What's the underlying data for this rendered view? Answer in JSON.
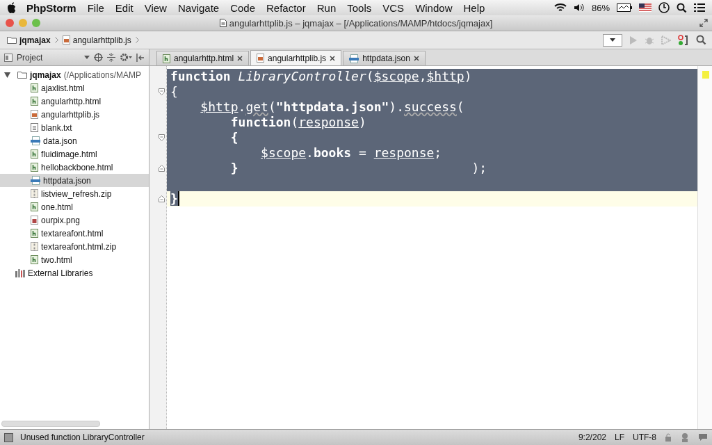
{
  "menubar": {
    "app": "PhpStorm",
    "items": [
      "File",
      "Edit",
      "View",
      "Navigate",
      "Code",
      "Refactor",
      "Run",
      "Tools",
      "VCS",
      "Window",
      "Help"
    ],
    "battery": "86%"
  },
  "window": {
    "title": "angularhttplib.js – jqmajax – [/Applications/MAMP/htdocs/jqmajax]"
  },
  "breadcrumbs": [
    {
      "label": "jqmajax",
      "kind": "folder"
    },
    {
      "label": "angularhttplib.js",
      "kind": "js"
    }
  ],
  "project_panel": {
    "title": "Project"
  },
  "tabs": [
    {
      "label": "angularhttp.html",
      "kind": "html",
      "selected": false
    },
    {
      "label": "angularhttplib.js",
      "kind": "js",
      "selected": true
    },
    {
      "label": "httpdata.json",
      "kind": "json",
      "selected": false
    }
  ],
  "tree": {
    "label": "jqmajax",
    "path": "(/Applications/MAMP",
    "expanded": true,
    "children": [
      {
        "label": "ajaxlist.html",
        "kind": "html",
        "selected": false
      },
      {
        "label": "angularhttp.html",
        "kind": "html",
        "selected": false
      },
      {
        "label": "angularhttplib.js",
        "kind": "js",
        "selected": false
      },
      {
        "label": "blank.txt",
        "kind": "text",
        "selected": false
      },
      {
        "label": "data.json",
        "kind": "json",
        "selected": false
      },
      {
        "label": "fluidimage.html",
        "kind": "html",
        "selected": false
      },
      {
        "label": "hellobackbone.html",
        "kind": "html",
        "selected": false
      },
      {
        "label": "httpdata.json",
        "kind": "json",
        "selected": true
      },
      {
        "label": "listview_refresh.zip",
        "kind": "zip",
        "selected": false
      },
      {
        "label": "one.html",
        "kind": "html",
        "selected": false
      },
      {
        "label": "ourpix.png",
        "kind": "image",
        "selected": false
      },
      {
        "label": "textareafont.html",
        "kind": "html",
        "selected": false
      },
      {
        "label": "textareafont.html.zip",
        "kind": "zip",
        "selected": false
      },
      {
        "label": "two.html",
        "kind": "html",
        "selected": false
      }
    ]
  },
  "libraries": {
    "label": "External Libraries"
  },
  "code": {
    "lines": [
      {
        "selected": true,
        "current": false,
        "fold_start": false,
        "fold_end": false,
        "tokens": [
          {
            "text": "function",
            "kind": "keyword"
          },
          {
            "text": " LibraryController",
            "kind": "italic"
          },
          {
            "text": "(",
            "kind": "plain"
          },
          {
            "text": "$scope",
            "kind": "var"
          },
          {
            "text": ",",
            "kind": "plain"
          },
          {
            "text": "$http",
            "kind": "var"
          },
          {
            "text": ")",
            "kind": "plain"
          }
        ]
      },
      {
        "selected": true,
        "current": false,
        "fold_start": true,
        "fold_end": false,
        "tokens": [
          {
            "text": "{",
            "kind": "plain"
          }
        ]
      },
      {
        "selected": true,
        "current": false,
        "fold_start": false,
        "fold_end": false,
        "tokens": [
          {
            "text": "    $http",
            "kind": "var"
          },
          {
            "text": ".",
            "kind": "plain"
          },
          {
            "text": "get",
            "kind": "warn"
          },
          {
            "text": "(",
            "kind": "plain"
          },
          {
            "text": "\"httpdata.json\"",
            "kind": "string"
          },
          {
            "text": ").",
            "kind": "plain"
          },
          {
            "text": "success",
            "kind": "warn"
          },
          {
            "text": "(",
            "kind": "plain"
          }
        ]
      },
      {
        "selected": true,
        "current": false,
        "fold_start": false,
        "fold_end": false,
        "tokens": [
          {
            "text": "        function",
            "kind": "keyword"
          },
          {
            "text": "(",
            "kind": "plain"
          },
          {
            "text": "response",
            "kind": "var"
          },
          {
            "text": ")",
            "kind": "plain"
          }
        ]
      },
      {
        "selected": true,
        "current": false,
        "fold_start": true,
        "fold_end": false,
        "tokens": [
          {
            "text": "        {",
            "kind": "keyword"
          }
        ]
      },
      {
        "selected": true,
        "current": false,
        "fold_start": false,
        "fold_end": false,
        "tokens": [
          {
            "text": "            $scope",
            "kind": "var"
          },
          {
            "text": ".",
            "kind": "plain"
          },
          {
            "text": "books",
            "kind": "keyword"
          },
          {
            "text": " = ",
            "kind": "plain"
          },
          {
            "text": "response",
            "kind": "var"
          },
          {
            "text": ";",
            "kind": "plain"
          }
        ]
      },
      {
        "selected": true,
        "current": false,
        "fold_start": false,
        "fold_end": true,
        "tokens": [
          {
            "text": "        }",
            "kind": "keyword"
          },
          {
            "text": "                               );",
            "kind": "plain"
          }
        ]
      },
      {
        "selected": true,
        "current": false,
        "fold_start": false,
        "fold_end": false
      },
      {
        "selected": false,
        "current": true,
        "fold_start": false,
        "fold_end": true,
        "tokens": [
          {
            "text": "}",
            "kind": "selected"
          }
        ]
      }
    ]
  },
  "status_bar": {
    "message": "Unused function LibraryController",
    "position": "9:2/202",
    "line_ending": "LF",
    "encoding": "UTF-8"
  }
}
